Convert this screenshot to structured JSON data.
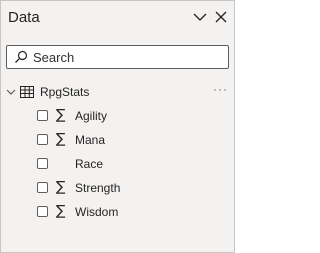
{
  "pane": {
    "title": "Data",
    "header_icons": [
      "chevron-down-icon",
      "close-icon"
    ]
  },
  "search": {
    "placeholder": "Search",
    "value": "",
    "icon": "search-icon"
  },
  "table": {
    "name": "RpgStats",
    "icon": "table-icon",
    "expanded": true,
    "more_label": "···"
  },
  "fields": [
    {
      "name": "Agility",
      "aggregate": true,
      "checked": false
    },
    {
      "name": "Mana",
      "aggregate": true,
      "checked": false
    },
    {
      "name": "Race",
      "aggregate": false,
      "checked": false
    },
    {
      "name": "Strength",
      "aggregate": true,
      "checked": false
    },
    {
      "name": "Wisdom",
      "aggregate": true,
      "checked": false
    }
  ],
  "sigma_glyph": "∑",
  "colors": {
    "background": "#f3f2f1",
    "border": "#c8c6c4",
    "text": "#252423"
  }
}
